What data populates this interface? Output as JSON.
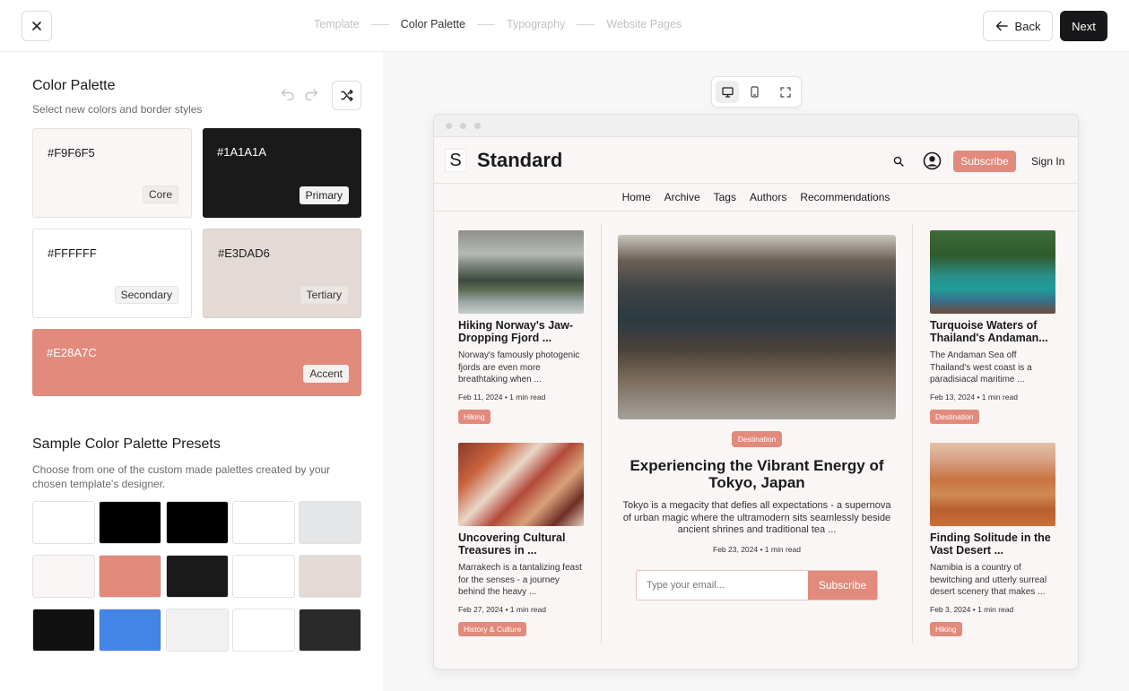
{
  "topbar": {
    "steps": [
      {
        "label": "Template",
        "active": false
      },
      {
        "label": "Color Palette",
        "active": true
      },
      {
        "label": "Typography",
        "active": false
      },
      {
        "label": "Website Pages",
        "active": false
      }
    ],
    "back_label": "Back",
    "next_label": "Next"
  },
  "palette": {
    "title": "Color Palette",
    "subtitle": "Select new colors and border styles",
    "swatches": {
      "core": {
        "hex": "#F9F6F5",
        "role": "Core"
      },
      "primary": {
        "hex": "#1A1A1A",
        "role": "Primary"
      },
      "secondary": {
        "hex": "#FFFFFF",
        "role": "Secondary"
      },
      "tertiary": {
        "hex": "#E3DAD6",
        "role": "Tertiary"
      },
      "accent": {
        "hex": "#E28A7C",
        "role": "Accent"
      }
    }
  },
  "presets": {
    "title": "Sample Color Palette Presets",
    "subtitle": "Choose from one of the custom made palettes created by your chosen template's designer.",
    "rows": [
      [
        "#ffffff",
        "#000000",
        "#000000",
        "#ffffff",
        "#e5e6e8"
      ],
      [
        "#f9f6f5",
        "#e28a7c",
        "#1a1a1a",
        "#ffffff",
        "#e3dad6"
      ],
      [
        "#111111",
        "#4285e6",
        "#f1f1f1",
        "#ffffff",
        "#2a2a2a"
      ]
    ]
  },
  "preview": {
    "site": {
      "logo_letter": "S",
      "name": "Standard",
      "subscribe_label": "Subscribe",
      "signin_label": "Sign In",
      "nav": [
        "Home",
        "Archive",
        "Tags",
        "Authors",
        "Recommendations"
      ]
    },
    "cards": {
      "left_top": {
        "title": "Hiking Norway's Jaw-Dropping Fjord ...",
        "excerpt": "Norway's famously photogenic fjords are even more breathtaking when ...",
        "meta": "Feb 11, 2024 • 1 min read",
        "tag": "Hiking"
      },
      "left_bottom": {
        "title": "Uncovering Cultural Treasures in ...",
        "excerpt": "Marrakech is a tantalizing feast for the senses - a journey behind the heavy ...",
        "meta": "Feb 27, 2024 • 1 min read",
        "tag": "History & Culture"
      },
      "right_top": {
        "title": "Turquoise Waters of Thailand's Andaman...",
        "excerpt": "The Andaman Sea off Thailand's west coast is a paradisiacal maritime ...",
        "meta": "Feb 13, 2024 • 1 min read",
        "tag": "Destination"
      },
      "right_bottom": {
        "title": "Finding Solitude in the Vast Desert ...",
        "excerpt": "Namibia is a country of bewitching and utterly surreal desert scenery that makes ...",
        "meta": "Feb 3, 2024 • 1 min read",
        "tag": "Hiking"
      }
    },
    "feature": {
      "tag": "Destination",
      "title": "Experiencing the Vibrant Energy of Tokyo, Japan",
      "excerpt": "Tokyo is a megacity that defies all expectations - a supernova of urban magic where the ultramodern sits seamlessly beside ancient shrines and traditional tea ...",
      "meta": "Feb 23, 2024 • 1 min read"
    },
    "newsletter": {
      "placeholder": "Type your email...",
      "button_label": "Subscribe"
    }
  },
  "colors": {
    "accent": "#E28A7C",
    "primary": "#1A1A1A",
    "next_button": "#18181B"
  }
}
